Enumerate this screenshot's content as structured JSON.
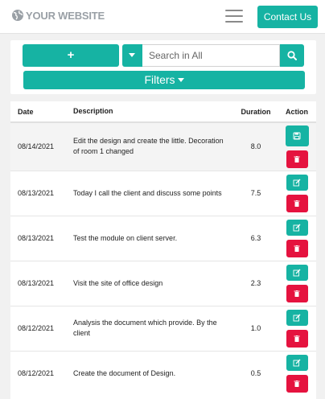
{
  "header": {
    "brand": "YOUR WEBSITE",
    "contact_label": "Contact Us"
  },
  "toolbar": {
    "add_label": "+",
    "search_placeholder": "Search in All",
    "filters_label": "Filters"
  },
  "colors": {
    "accent": "#16b3a3",
    "danger": "#e5133f"
  },
  "table": {
    "headers": {
      "date": "Date",
      "description": "Description",
      "duration": "Duration",
      "action": "Action"
    },
    "rows": [
      {
        "date": "08/14/2021",
        "description": "Edit the design and create the little. Decoration of room 1 changed",
        "duration": "8.0"
      },
      {
        "date": "08/13/2021",
        "description": "Today I call the client and discuss some points",
        "duration": "7.5"
      },
      {
        "date": "08/13/2021",
        "description": "Test the module on client server.",
        "duration": "6.3"
      },
      {
        "date": "08/13/2021",
        "description": "Visit the site of office design",
        "duration": "2.3"
      },
      {
        "date": "08/12/2021",
        "description": "Analysis the document which provide. By the client",
        "duration": "1.0"
      },
      {
        "date": "08/12/2021",
        "description": "Create the document of Design.",
        "duration": "0.5"
      }
    ]
  }
}
